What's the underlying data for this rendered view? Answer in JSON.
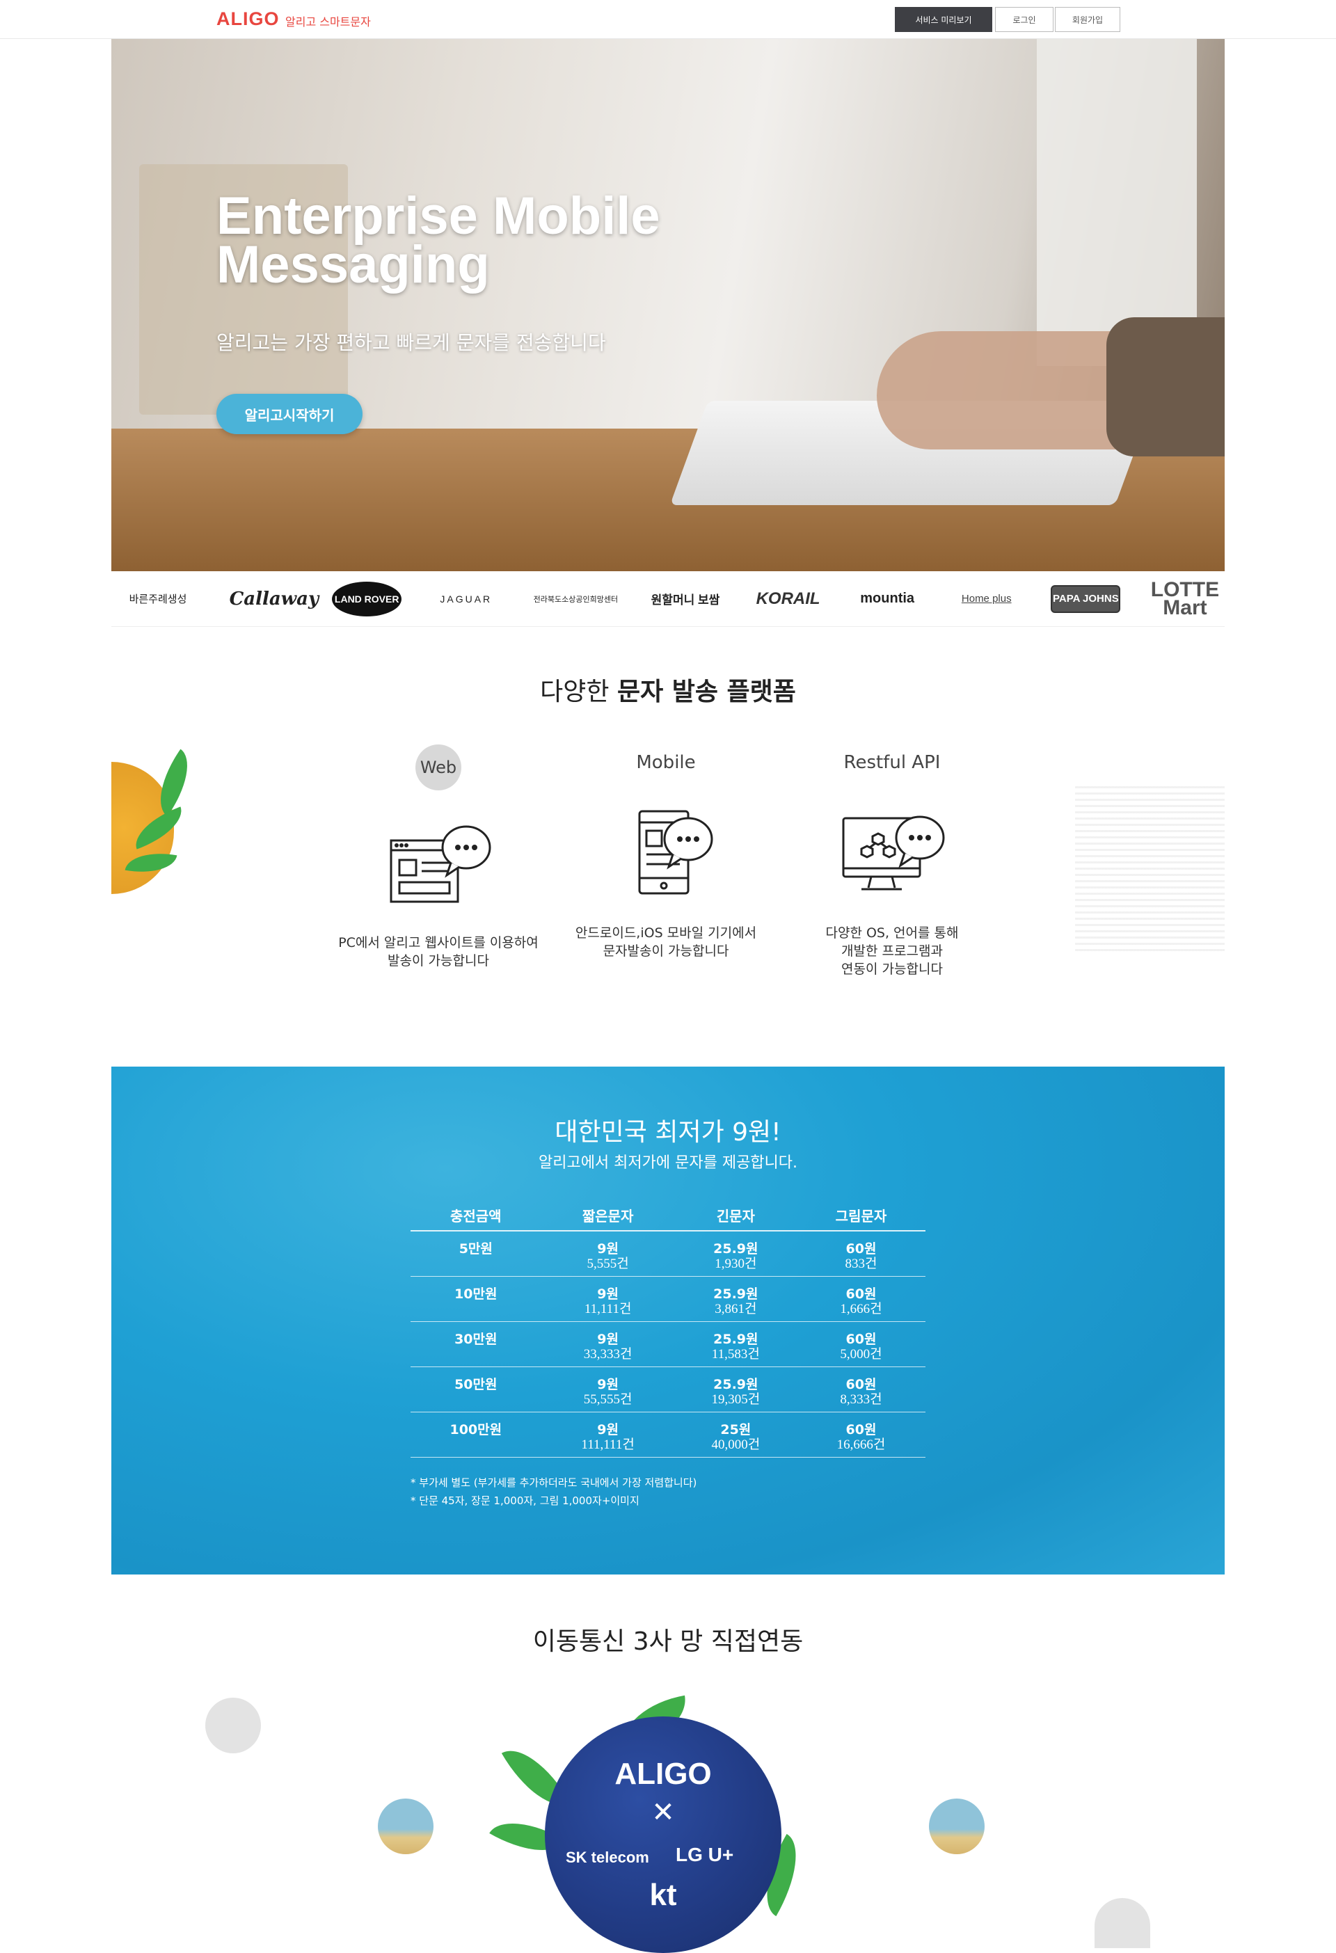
{
  "header": {
    "logo": "ALIGO",
    "logo_sub": "알리고 스마트문자",
    "buttons": [
      "서비스 미리보기",
      "로그인",
      "회원가입"
    ]
  },
  "hero": {
    "title": "Enterprise Mobile Messaging",
    "subtitle": "알리고는 가장 편하고 빠르게 문자를 전송합니다",
    "cta": "알리고시작하기"
  },
  "logos": [
    "바른주례생성",
    "Callaway",
    "LAND ROVER",
    "JAGUAR",
    "전라북도소상공인희망센터",
    "원할머니 보쌈",
    "KORAIL",
    "mountia",
    "Home plus",
    "PAPA JOHNS",
    "LOTTE Mart"
  ],
  "platform": {
    "title_light": "다양한",
    "title_bold": "문자 발송 플랫폼",
    "items": [
      {
        "name": "Web",
        "icon": "web-chat-icon",
        "desc1": "PC에서 알리고 웹사이트를 이용하여",
        "desc2": "발송이 가능합니다",
        "desc3": ""
      },
      {
        "name": "Mobile",
        "icon": "mobile-chat-icon",
        "desc1": "안드로이드,iOS 모바일 기기에서",
        "desc2": "문자발송이 가능합니다",
        "desc3": ""
      },
      {
        "name": "Restful API",
        "icon": "api-chat-icon",
        "desc1": "다양한 OS, 언어를 통해",
        "desc2": "개발한 프로그램과",
        "desc3": "연동이 가능합니다"
      }
    ]
  },
  "pricing": {
    "title": "대한민국 최저가 9원!",
    "subtitle": "알리고에서 최저가에 문자를 제공합니다.",
    "headers": [
      "충전금액",
      "짧은문자",
      "긴문자",
      "그림문자"
    ],
    "rows": [
      {
        "amount": "5만원",
        "sms": "9원",
        "sms_n": "5,555건",
        "lms": "25.9원",
        "lms_n": "1,930건",
        "mms": "60원",
        "mms_n": "833건"
      },
      {
        "amount": "10만원",
        "sms": "9원",
        "sms_n": "11,111건",
        "lms": "25.9원",
        "lms_n": "3,861건",
        "mms": "60원",
        "mms_n": "1,666건"
      },
      {
        "amount": "30만원",
        "sms": "9원",
        "sms_n": "33,333건",
        "lms": "25.9원",
        "lms_n": "11,583건",
        "mms": "60원",
        "mms_n": "5,000건"
      },
      {
        "amount": "50만원",
        "sms": "9원",
        "sms_n": "55,555건",
        "lms": "25.9원",
        "lms_n": "19,305건",
        "mms": "60원",
        "mms_n": "8,333건"
      },
      {
        "amount": "100만원",
        "sms": "9원",
        "sms_n": "111,111건",
        "lms": "25원",
        "lms_n": "40,000건",
        "mms": "60원",
        "mms_n": "16,666건"
      }
    ],
    "notes": [
      "* 부가세 별도 (부가세를 추가하더라도 국내에서 가장 저렴합니다)",
      "* 단문 45자, 장문 1,000자, 그림 1,000자+이미지"
    ]
  },
  "carriers": {
    "title": "이동통신 3사 망 직접연동",
    "logo": "ALIGO",
    "times": "✕",
    "sk": "SK telecom",
    "lg": "LG U+",
    "kt": "kt"
  },
  "colors": {
    "brand_red": "#e8463f",
    "accent_blue": "#4bb3d8",
    "price_bg": "#1fa0d4",
    "dark_button": "#3e3f44"
  }
}
